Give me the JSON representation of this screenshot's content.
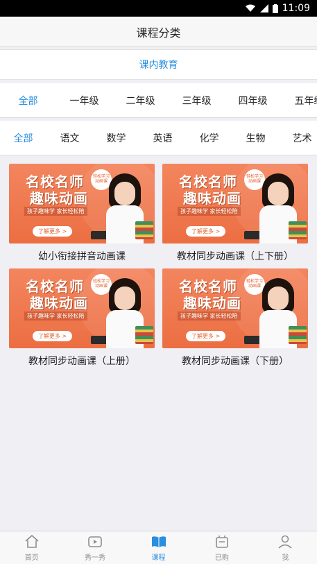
{
  "status": {
    "time": "11:09"
  },
  "header": {
    "title": "课程分类"
  },
  "section": {
    "label": "课内教育"
  },
  "grades": [
    "全部",
    "一年级",
    "二年级",
    "三年级",
    "四年级",
    "五年级"
  ],
  "subjects": [
    "全部",
    "语文",
    "数学",
    "英语",
    "化学",
    "生物",
    "艺术"
  ],
  "banner": {
    "title1": "名校名师",
    "title2": "趣味动画",
    "tagline": "孩子趣味学  家长轻松陪",
    "more": "了解更多 >",
    "bubble": "轻松学习 动画课"
  },
  "courses": [
    {
      "title": "幼小衔接拼音动画课"
    },
    {
      "title": "教材同步动画课（上下册）"
    },
    {
      "title": "教材同步动画课（上册）"
    },
    {
      "title": "教材同步动画课（下册）"
    }
  ],
  "tabs": [
    {
      "label": "首页",
      "icon": "home-icon"
    },
    {
      "label": "秀一秀",
      "icon": "play-icon"
    },
    {
      "label": "课程",
      "icon": "book-icon"
    },
    {
      "label": "已购",
      "icon": "bag-icon"
    },
    {
      "label": "我",
      "icon": "user-icon"
    }
  ],
  "colors": {
    "accent": "#2a8fe0",
    "banner": "#ec6e42"
  }
}
